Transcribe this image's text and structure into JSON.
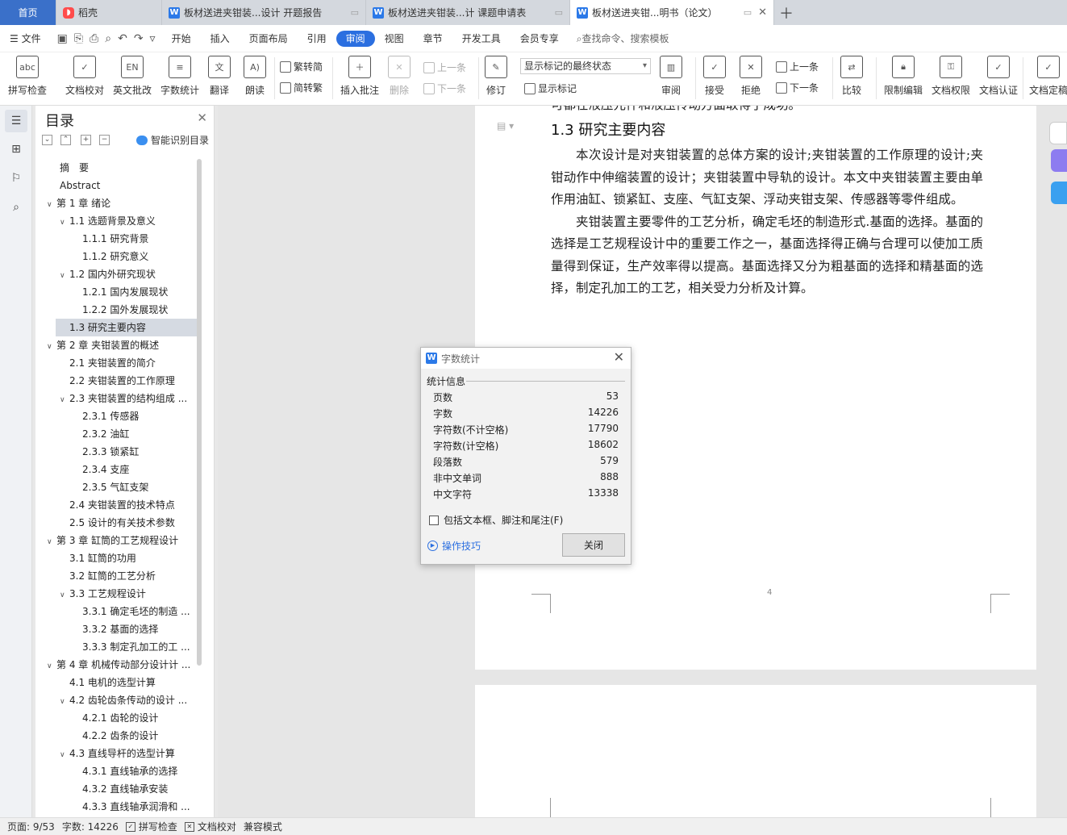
{
  "tabs": [
    {
      "label": "首页"
    },
    {
      "label": "稻壳"
    },
    {
      "label": "板材送进夹钳装...设计 开题报告"
    },
    {
      "label": "板材送进夹钳装...计 课题申请表"
    },
    {
      "label": "板材送进夹钳...明书（论文）"
    }
  ],
  "menu": {
    "file": "文件",
    "items": [
      "开始",
      "插入",
      "页面布局",
      "引用",
      "审阅",
      "视图",
      "章节",
      "开发工具",
      "会员专享"
    ],
    "active": "审阅",
    "search": "查找命令、搜索模板"
  },
  "ribbon": {
    "spellcheck": "拼写检查",
    "doc_proof": "文档校对",
    "eng_review": "英文批改",
    "word_count": "字数统计",
    "translate": "翻译",
    "read_aloud": "朗读",
    "trad": "繁转简",
    "simp": "简转繁",
    "insert_comment": "插入批注",
    "delete": "删除",
    "prev1": "上一条",
    "next1": "下一条",
    "track": "修订",
    "markup_state": "显示标记的最终状态",
    "show_markup": "显示标记",
    "review": "审阅",
    "accept": "接受",
    "reject": "拒绝",
    "prev2": "上一条",
    "next2": "下一条",
    "compare": "比较",
    "restrict": "限制编辑",
    "doc_rights": "文档权限",
    "doc_cert": "文档认证",
    "doc_final": "文档定稿"
  },
  "toc": {
    "title": "目录",
    "smart": "智能识别目录",
    "items": [
      {
        "label": "摘　要",
        "level": 0,
        "arrow": ""
      },
      {
        "label": "Abstract",
        "level": 0,
        "arrow": ""
      },
      {
        "label": "第 1 章 绪论",
        "level": 0,
        "arrow": "v"
      },
      {
        "label": "1.1 选题背景及意义",
        "level": 1,
        "arrow": "v"
      },
      {
        "label": "1.1.1 研究背景",
        "level": 2,
        "arrow": ""
      },
      {
        "label": "1.1.2 研究意义",
        "level": 2,
        "arrow": ""
      },
      {
        "label": "1.2 国内外研究现状",
        "level": 1,
        "arrow": "v"
      },
      {
        "label": "1.2.1 国内发展现状",
        "level": 2,
        "arrow": ""
      },
      {
        "label": "1.2.2 国外发展现状",
        "level": 2,
        "arrow": ""
      },
      {
        "label": "1.3 研究主要内容",
        "level": 1,
        "arrow": "",
        "selected": true
      },
      {
        "label": "第 2 章  夹钳装置的概述",
        "level": 0,
        "arrow": "v"
      },
      {
        "label": "2.1  夹钳装置的简介",
        "level": 1,
        "arrow": ""
      },
      {
        "label": "2.2  夹钳装置的工作原理",
        "level": 1,
        "arrow": ""
      },
      {
        "label": "2.3  夹钳装置的结构组成 ...",
        "level": 1,
        "arrow": "v"
      },
      {
        "label": "2.3.1 传感器",
        "level": 2,
        "arrow": ""
      },
      {
        "label": "2.3.2  油缸",
        "level": 2,
        "arrow": ""
      },
      {
        "label": "2.3.3  锁紧缸",
        "level": 2,
        "arrow": ""
      },
      {
        "label": "2.3.4  支座",
        "level": 2,
        "arrow": ""
      },
      {
        "label": "2.3.5  气缸支架",
        "level": 2,
        "arrow": ""
      },
      {
        "label": "2.4  夹钳装置的技术特点",
        "level": 1,
        "arrow": ""
      },
      {
        "label": "2.5  设计的有关技术参数",
        "level": 1,
        "arrow": ""
      },
      {
        "label": "第 3 章  缸筒的工艺规程设计",
        "level": 0,
        "arrow": "v"
      },
      {
        "label": "3.1  缸筒的功用",
        "level": 1,
        "arrow": ""
      },
      {
        "label": "3.2  缸筒的工艺分析",
        "level": 1,
        "arrow": ""
      },
      {
        "label": "3.3  工艺规程设计",
        "level": 1,
        "arrow": "v"
      },
      {
        "label": "3.3.1  确定毛坯的制造 ...",
        "level": 2,
        "arrow": ""
      },
      {
        "label": "3.3.2  基面的选择",
        "level": 2,
        "arrow": ""
      },
      {
        "label": "3.3.3  制定孔加工的工 ...",
        "level": 2,
        "arrow": ""
      },
      {
        "label": "第 4 章  机械传动部分设计计 ...",
        "level": 0,
        "arrow": "v"
      },
      {
        "label": "4.1 电机的选型计算",
        "level": 1,
        "arrow": ""
      },
      {
        "label": "4.2 齿轮齿条传动的设计 ...",
        "level": 1,
        "arrow": "v"
      },
      {
        "label": "4.2.1 齿轮的设计",
        "level": 2,
        "arrow": ""
      },
      {
        "label": "4.2.2 齿条的设计",
        "level": 2,
        "arrow": ""
      },
      {
        "label": "4.3 直线导杆的选型计算",
        "level": 1,
        "arrow": "v"
      },
      {
        "label": "4.3.1 直线轴承的选择",
        "level": 2,
        "arrow": ""
      },
      {
        "label": "4.3.2 直线轴承安装",
        "level": 2,
        "arrow": ""
      },
      {
        "label": "4.3.3 直线轴承润滑和 ...",
        "level": 2,
        "arrow": ""
      }
    ]
  },
  "doc": {
    "cut_line": "可都在液压元件和液压传动方面取得了成功。",
    "heading": "1.3 研究主要内容",
    "para1": "本次设计是对夹钳装置的总体方案的设计;夹钳装置的工作原理的设计;夹钳动作中伸缩装置的设计；夹钳装置中导轨的设计。本文中夹钳装置主要由单作用油缸、锁紧缸、支座、气缸支架、浮动夹钳支架、传感器等零件组成。",
    "para2": "夹钳装置主要零件的工艺分析，确定毛坯的制造形式.基面的选择。基面的选择是工艺规程设计中的重要工作之一，基面选择得正确与合理可以使加工质量得到保证，生产效率得以提高。基面选择又分为粗基面的选择和精基面的选择，制定孔加工的工艺，相关受力分析及计算。",
    "page_number": "4"
  },
  "dialog": {
    "title": "字数统计",
    "section": "统计信息",
    "stats": [
      {
        "label": "页数",
        "value": "53"
      },
      {
        "label": "字数",
        "value": "14226"
      },
      {
        "label": "字符数(不计空格)",
        "value": "17790"
      },
      {
        "label": "字符数(计空格)",
        "value": "18602"
      },
      {
        "label": "段落数",
        "value": "579"
      },
      {
        "label": "非中文单词",
        "value": "888"
      },
      {
        "label": "中文字符",
        "value": "13338"
      }
    ],
    "checkbox": "包括文本框、脚注和尾注(F)",
    "tips": "操作技巧",
    "close": "关闭"
  },
  "status": {
    "page": "页面: 9/53",
    "words": "字数: 14226",
    "spell": "拼写检查",
    "proof": "文档校对",
    "compat": "兼容模式"
  },
  "colors": {
    "accent": "#2b6fe0",
    "home_tab": "#3a70c9",
    "tab_bar": "#d4d8de"
  }
}
